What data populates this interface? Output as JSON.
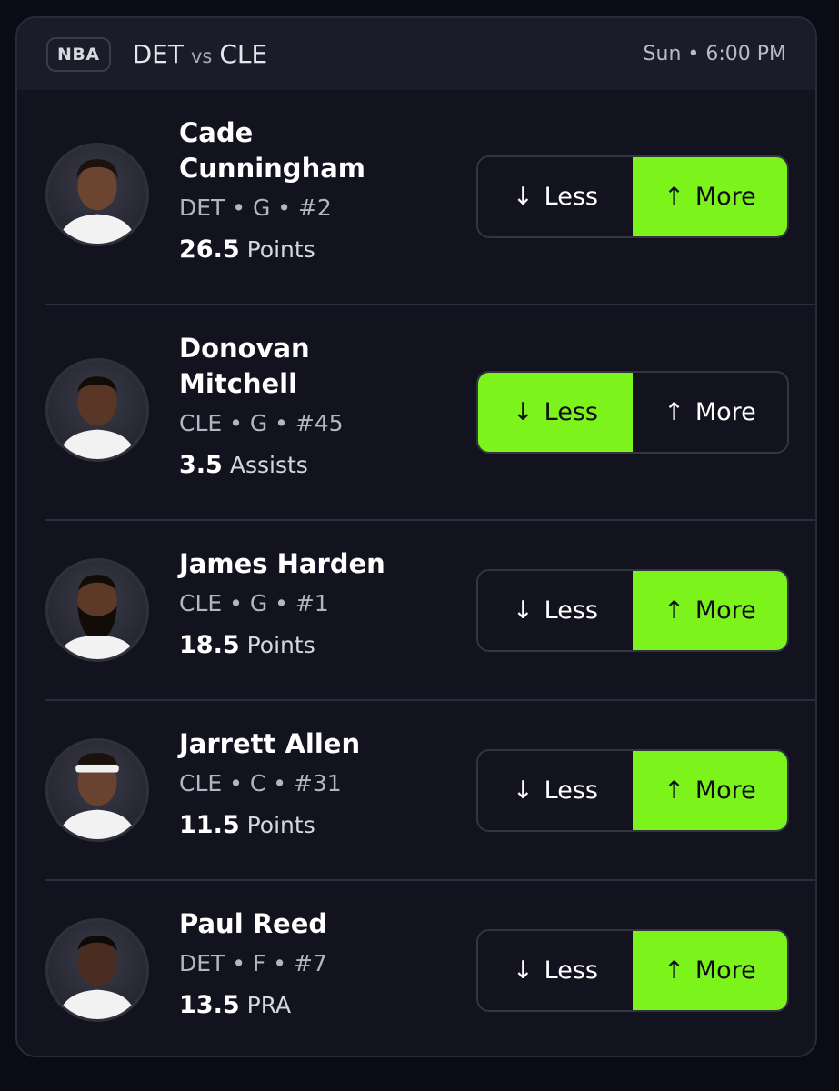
{
  "header": {
    "league": "NBA",
    "home_team": "DET",
    "vs": "vs",
    "away_team": "CLE",
    "time": "Sun • 6:00 PM"
  },
  "accent_color": "#7cf41c",
  "players": [
    {
      "name_line1": "Cade",
      "name_line2": "Cunningham",
      "meta": "DET • G • #2",
      "line_value": "26.5",
      "stat": "Points",
      "less_label": "Less",
      "more_label": "More",
      "selected": "more",
      "skin": "#6b4530",
      "jersey": "#f2f2f2"
    },
    {
      "name_line1": "Donovan",
      "name_line2": "Mitchell",
      "meta": "CLE • G • #45",
      "line_value": "3.5",
      "stat": "Assists",
      "less_label": "Less",
      "more_label": "More",
      "selected": "less",
      "skin": "#5a3626",
      "jersey": "#f2f2f2"
    },
    {
      "name_line1": "James Harden",
      "name_line2": "",
      "meta": "CLE • G • #1",
      "line_value": "18.5",
      "stat": "Points",
      "less_label": "Less",
      "more_label": "More",
      "selected": "more",
      "skin": "#5d3a28",
      "jersey": "#f2f2f2"
    },
    {
      "name_line1": "Jarrett Allen",
      "name_line2": "",
      "meta": "CLE • C • #31",
      "line_value": "11.5",
      "stat": "Points",
      "less_label": "Less",
      "more_label": "More",
      "selected": "more",
      "skin": "#6a4330",
      "jersey": "#f2f2f2"
    },
    {
      "name_line1": "Paul Reed",
      "name_line2": "",
      "meta": "DET • F • #7",
      "line_value": "13.5",
      "stat": "PRA",
      "less_label": "Less",
      "more_label": "More",
      "selected": "more",
      "skin": "#4a2d20",
      "jersey": "#f2f2f2"
    }
  ]
}
